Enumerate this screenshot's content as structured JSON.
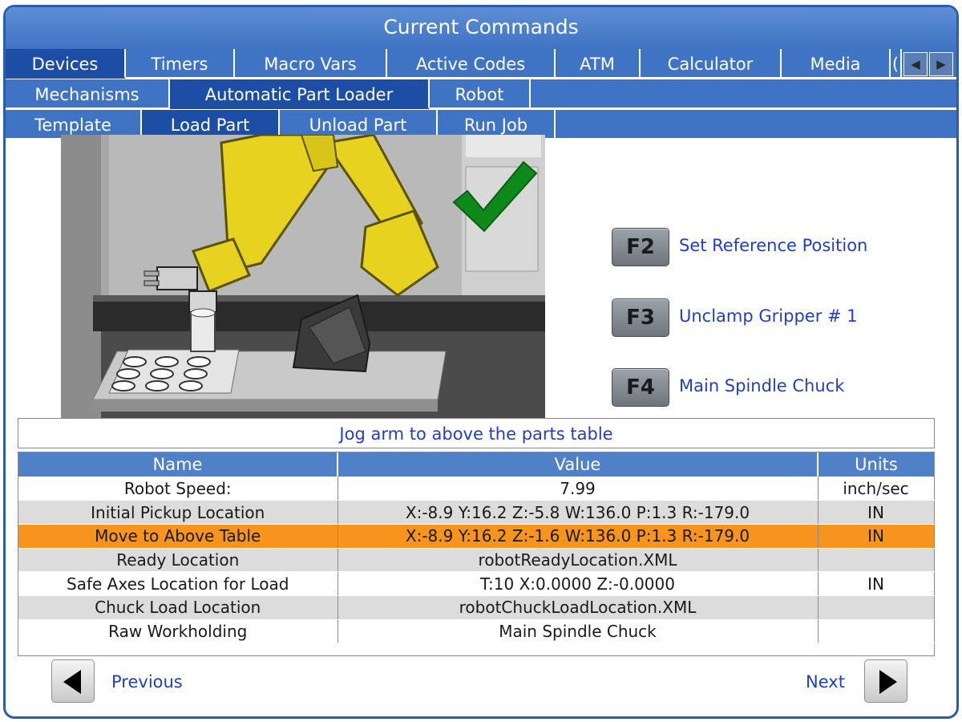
{
  "title": "Current Commands",
  "tabs_row1": [
    "Devices",
    "Timers",
    "Macro Vars",
    "Active Codes",
    "ATM",
    "Calculator",
    "Media",
    "("
  ],
  "tabs_row2": [
    "Mechanisms",
    "Automatic Part Loader",
    "Robot"
  ],
  "tabs_row3": [
    "Template",
    "Load Part",
    "Unload Part",
    "Run Job"
  ],
  "fkeys": [
    {
      "key": "F2",
      "label": "Set Reference Position"
    },
    {
      "key": "F3",
      "label": "Unclamp Gripper # 1"
    },
    {
      "key": "F4",
      "label": "Main Spindle Chuck"
    }
  ],
  "instruction": "Jog arm to above the parts table",
  "table": {
    "headers": [
      "Name",
      "Value",
      "Units"
    ],
    "rows": [
      {
        "name": "Robot Speed:",
        "value": "7.99",
        "units": "inch/sec"
      },
      {
        "name": "Initial Pickup Location",
        "value": "X:-8.9 Y:16.2 Z:-5.8 W:136.0 P:1.3 R:-179.0",
        "units": "IN"
      },
      {
        "name": "Move to Above Table",
        "value": "X:-8.9 Y:16.2 Z:-1.6 W:136.0 P:1.3 R:-179.0",
        "units": "IN"
      },
      {
        "name": "Ready Location",
        "value": "robotReadyLocation.XML",
        "units": ""
      },
      {
        "name": "Safe Axes Location for Load",
        "value": "T:10 X:0.0000 Z:-0.0000",
        "units": "IN"
      },
      {
        "name": "Chuck Load Location",
        "value": "robotChuckLoadLocation.XML",
        "units": ""
      },
      {
        "name": "Raw Workholding",
        "value": "Main Spindle Chuck",
        "units": ""
      }
    ]
  },
  "nav": {
    "previous": "Previous",
    "next": "Next"
  },
  "icons": {
    "scroll_left": "triangle-left",
    "scroll_right": "triangle-right",
    "status": "green-checkmark",
    "prev": "black-triangle-left",
    "next": "black-triangle-right"
  },
  "colors": {
    "tab_blue": "#3f74c4",
    "tab_active": "#1c4ea6",
    "label_blue": "#1f3fc8",
    "selected_row": "#f7941d",
    "check_green": "#0e8a1a",
    "robot_yellow": "#e6d21f"
  }
}
